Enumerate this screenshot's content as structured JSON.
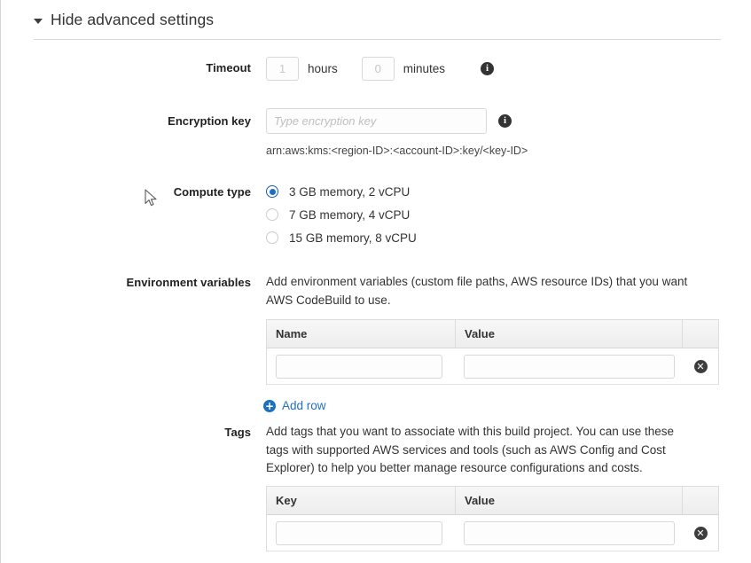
{
  "section": {
    "toggle_label": "Hide advanced settings",
    "caret_icon": "caret-down-icon"
  },
  "timeout": {
    "label": "Timeout",
    "hours_placeholder": "1",
    "hours_value": "",
    "hours_unit": "hours",
    "minutes_placeholder": "0",
    "minutes_value": "",
    "minutes_unit": "minutes",
    "info_icon": "info-icon",
    "info_glyph": "i"
  },
  "encryption": {
    "label": "Encryption key",
    "placeholder": "Type encryption key",
    "value": "",
    "hint": "arn:aws:kms:<region-ID>:<account-ID>:key/<key-ID>",
    "info_icon": "info-icon",
    "info_glyph": "i"
  },
  "compute_type": {
    "label": "Compute type",
    "selected_index": 0,
    "options": [
      {
        "label": "3 GB memory, 2 vCPU",
        "selected": true
      },
      {
        "label": "7 GB memory, 4 vCPU",
        "selected": false
      },
      {
        "label": "15 GB memory, 8 vCPU",
        "selected": false
      }
    ]
  },
  "environment_variables": {
    "label": "Environment variables",
    "description": "Add environment variables (custom file paths, AWS resource IDs) that you want AWS CodeBuild to use.",
    "columns": [
      "Name",
      "Value",
      ""
    ],
    "rows": [
      {
        "name": "",
        "value": "",
        "remove_glyph": "✕"
      }
    ],
    "add_row_label": "Add row",
    "add_row_glyph": "+"
  },
  "tags": {
    "label": "Tags",
    "description": "Add tags that you want to associate with this build project. You can use these tags with supported AWS services and tools (such as AWS Config and Cost Explorer) to help you better manage resource configurations and costs.",
    "columns": [
      "Key",
      "Value",
      ""
    ],
    "rows": [
      {
        "key": "",
        "value": "",
        "remove_glyph": "✕"
      }
    ]
  },
  "colors": {
    "accent": "#1f6fbf",
    "text": "#333333",
    "border": "#dddddd",
    "placeholder": "#bfbfbf"
  }
}
